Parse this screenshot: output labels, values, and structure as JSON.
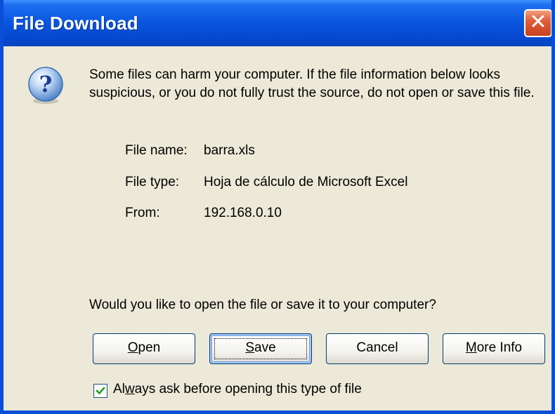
{
  "window": {
    "title": "File Download",
    "close_label": "✕"
  },
  "dialog": {
    "icon": "question-icon",
    "warning": "Some files can harm your computer. If the file information below looks suspicious, or you do not fully trust the source, do not open or save this file.",
    "file_info": {
      "name_label": "File name:",
      "name_value": "barra.xls",
      "type_label": "File type:",
      "type_value": "Hoja de cálculo de Microsoft Excel",
      "from_label": "From:",
      "from_value": "192.168.0.10"
    },
    "question": "Would you like to open the file or save it to your computer?",
    "buttons": {
      "open": {
        "mnemonic": "O",
        "rest": "pen"
      },
      "save": {
        "mnemonic": "S",
        "rest": "ave"
      },
      "cancel": "Cancel",
      "more_info": {
        "mnemonic": "M",
        "rest": "ore Info"
      }
    },
    "checkbox": {
      "checked": true,
      "label_pre": "Al",
      "label_mnemonic": "w",
      "label_post": "ays ask before opening this type of file"
    }
  },
  "colors": {
    "titlebar": "#0a58e0",
    "face": "#ece9d8",
    "close": "#e0603a",
    "check": "#21a121"
  }
}
